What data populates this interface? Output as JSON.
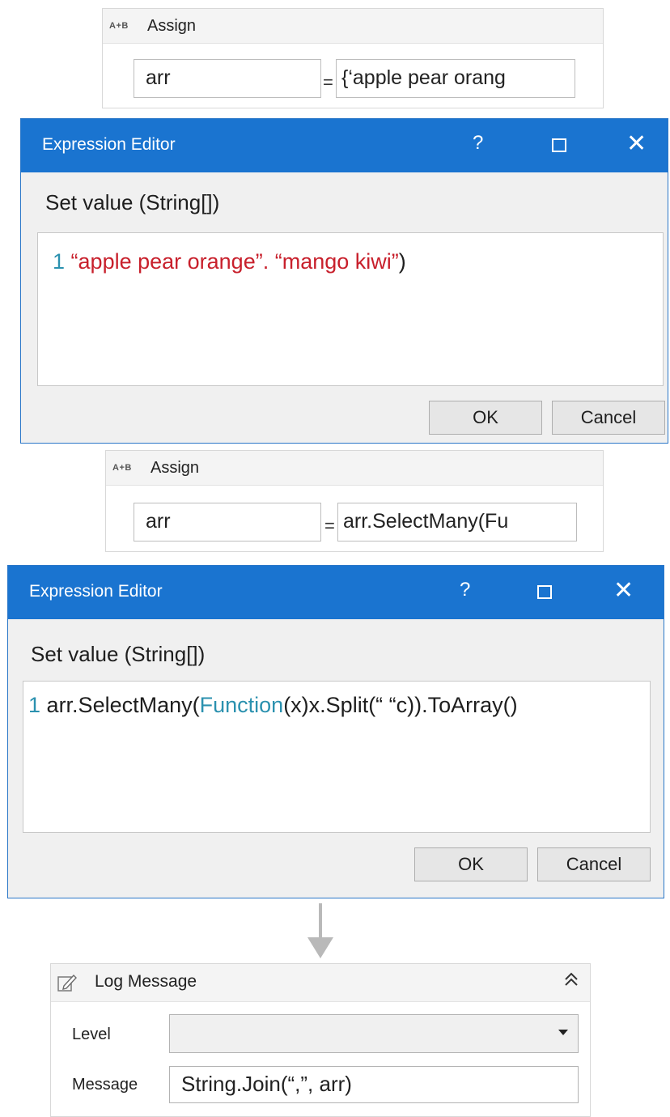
{
  "assign1": {
    "badge": "A+B",
    "title": "Assign",
    "to_value": "arr",
    "equals": "=",
    "value_value": "{‘apple pear orang"
  },
  "editor1": {
    "title": "Expression Editor",
    "help": "?",
    "close": "✕",
    "label": "Set value (String[])",
    "line_number": "1",
    "code_parts": [
      "“apple pear orange”. “mango kiwi”",
      ")"
    ],
    "ok": "OK",
    "cancel": "Cancel"
  },
  "assign2": {
    "badge": "A+B",
    "title": "Assign",
    "to_value": "arr",
    "equals": "=",
    "value_value": "arr.SelectMany(Fu"
  },
  "editor2": {
    "title": "Expression Editor",
    "help": "?",
    "close": "✕",
    "label": "Set value (String[])",
    "line_number": "1",
    "code_parts": [
      "arr.SelectMany(",
      "Function",
      "(x)x.Split(“ “c)).ToArray()"
    ],
    "ok": "OK",
    "cancel": "Cancel"
  },
  "log_message": {
    "title": "Log Message",
    "collapse": "≈",
    "level_label": "Level",
    "level_value": "",
    "message_label": "Message",
    "message_value": "String.Join(“,”, arr)"
  },
  "colors": {
    "titlebar": "#1a74d0",
    "string": "#c8202c",
    "keyword": "#2b91af"
  },
  "icons": [
    "pencil-edit-icon",
    "collapse-chevron-icon",
    "dropdown-caret-icon",
    "maximize-icon",
    "close-icon",
    "help-icon"
  ]
}
